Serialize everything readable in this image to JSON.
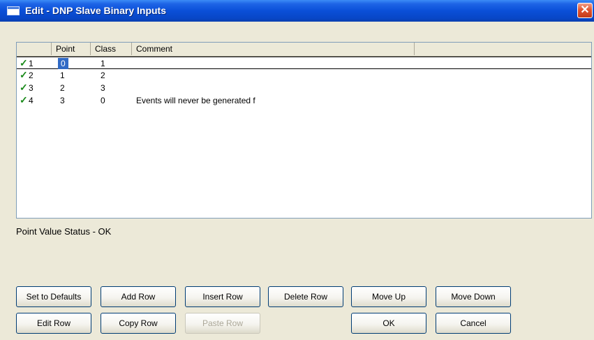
{
  "window": {
    "title": "Edit - DNP Slave Binary Inputs",
    "close_glyph": "✕"
  },
  "table": {
    "headers": [
      "Point",
      "Class",
      "Comment"
    ],
    "rows": [
      {
        "num": "1",
        "point": "0",
        "class": "1",
        "comment": "",
        "check": "✓"
      },
      {
        "num": "2",
        "point": "1",
        "class": "2",
        "comment": "",
        "check": "✓"
      },
      {
        "num": "3",
        "point": "2",
        "class": "3",
        "comment": "",
        "check": "✓"
      },
      {
        "num": "4",
        "point": "3",
        "class": "0",
        "comment": "Events will never be generated f",
        "check": "✓"
      }
    ]
  },
  "status": "Point Value Status - OK",
  "buttons": {
    "set_defaults": "Set to Defaults",
    "add_row": "Add Row",
    "insert_row": "Insert Row",
    "delete_row": "Delete Row",
    "move_up": "Move Up",
    "move_down": "Move Down",
    "edit_row": "Edit Row",
    "copy_row": "Copy Row",
    "paste_row": "Paste Row",
    "ok": "OK",
    "cancel": "Cancel"
  },
  "colors": {
    "titlebar": "#0a4fd8",
    "selection": "#316ac5",
    "check": "#1a8a1a"
  }
}
